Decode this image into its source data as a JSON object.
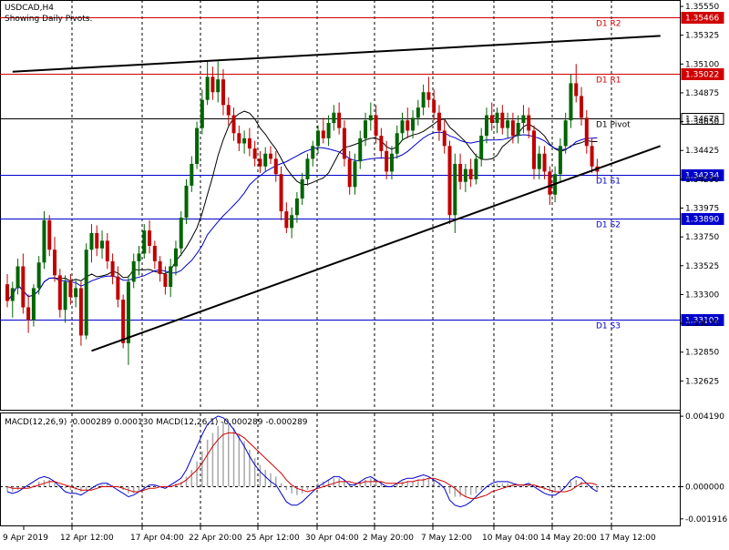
{
  "header": {
    "symbol": "USDCAD,H4",
    "subtitle": "Showing Daily Pivots.",
    "macd_label": "MACD(12,26,9) -0.000289 0.000130 MACD(12,26,1) -0.000289 -0.000289"
  },
  "colors": {
    "candle_up": "#006400",
    "candle_down": "#c00000",
    "pivot_red": "#d00000",
    "pivot_blue": "#0000cc",
    "pivot_black": "#000000",
    "ma_black": "#000000",
    "ma_blue": "#0000cc",
    "macd_hist": "#a8a8a8",
    "macd_main": "#0000cc",
    "macd_signal": "#d00000"
  },
  "chart_data": [
    {
      "type": "candlestick",
      "symbol": "USDCAD",
      "timeframe": "H4",
      "x_ticks": [
        "9 Apr 2019",
        "12 Apr 12:00",
        "17 Apr 04:00",
        "22 Apr 20:00",
        "25 Apr 12:00",
        "30 Apr 04:00",
        "2 May 20:00",
        "7 May 12:00",
        "10 May 04:00",
        "14 May 20:00",
        "17 May 12:00"
      ],
      "y_ticks": [
        "1.35550",
        "1.35325",
        "1.35100",
        "1.34875",
        "1.34650",
        "1.34425",
        "1.34200",
        "1.33975",
        "1.33750",
        "1.33525",
        "1.33300",
        "1.33075",
        "1.32850",
        "1.32625"
      ],
      "ylim": [
        1.324,
        1.356
      ],
      "pivots": [
        {
          "name": "D1 R2",
          "value": 1.35466,
          "label": "1.35466",
          "color": "red"
        },
        {
          "name": "D1 R1",
          "value": 1.35022,
          "label": "1.35022",
          "color": "red"
        },
        {
          "name": "D1 Pivot",
          "value": 1.34678,
          "label": "1.34678",
          "color": "black"
        },
        {
          "name": "D1 S1",
          "value": 1.34234,
          "label": "1.34234",
          "color": "blue"
        },
        {
          "name": "D1 S2",
          "value": 1.3389,
          "label": "1.33890",
          "color": "blue"
        },
        {
          "name": "D1 S3",
          "value": 1.33102,
          "label": "1.33102",
          "color": "blue"
        }
      ],
      "current_price": 1.34234,
      "trendlines": [
        {
          "from": {
            "bar": 1,
            "price": 1.3504
          },
          "to": {
            "bar": 124,
            "price": 1.3532
          }
        },
        {
          "from": {
            "bar": 16,
            "price": 1.3286
          },
          "to": {
            "bar": 124,
            "price": 1.3446
          }
        }
      ],
      "ohlc": [
        [
          1.3338,
          1.3346,
          1.332,
          1.3325
        ],
        [
          1.3325,
          1.334,
          1.3312,
          1.3335
        ],
        [
          1.3335,
          1.3358,
          1.333,
          1.3352
        ],
        [
          1.3352,
          1.3362,
          1.3315,
          1.332
        ],
        [
          1.332,
          1.333,
          1.33,
          1.331
        ],
        [
          1.331,
          1.3338,
          1.3305,
          1.3335
        ],
        [
          1.3335,
          1.336,
          1.333,
          1.3355
        ],
        [
          1.3355,
          1.3395,
          1.335,
          1.3388
        ],
        [
          1.3388,
          1.3392,
          1.336,
          1.3365
        ],
        [
          1.3365,
          1.3375,
          1.334,
          1.3345
        ],
        [
          1.3345,
          1.335,
          1.3312,
          1.3318
        ],
        [
          1.3318,
          1.3345,
          1.3308,
          1.334
        ],
        [
          1.334,
          1.3346,
          1.3322,
          1.3328
        ],
        [
          1.3328,
          1.3342,
          1.332,
          1.3335
        ],
        [
          1.3335,
          1.334,
          1.329,
          1.3298
        ],
        [
          1.3298,
          1.337,
          1.3295,
          1.3365
        ],
        [
          1.3365,
          1.3385,
          1.3355,
          1.3378
        ],
        [
          1.3378,
          1.3384,
          1.336,
          1.3366
        ],
        [
          1.3366,
          1.338,
          1.3358,
          1.3372
        ],
        [
          1.3372,
          1.3378,
          1.335,
          1.3356
        ],
        [
          1.3356,
          1.3362,
          1.3338,
          1.3344
        ],
        [
          1.3344,
          1.3352,
          1.332,
          1.3326
        ],
        [
          1.3326,
          1.333,
          1.3288,
          1.3292
        ],
        [
          1.3292,
          1.3345,
          1.3275,
          1.334
        ],
        [
          1.334,
          1.3362,
          1.3335,
          1.3356
        ],
        [
          1.3356,
          1.3368,
          1.3345,
          1.3362
        ],
        [
          1.3362,
          1.3385,
          1.3358,
          1.338
        ],
        [
          1.338,
          1.3388,
          1.3362,
          1.3368
        ],
        [
          1.3368,
          1.3372,
          1.335,
          1.3356
        ],
        [
          1.3356,
          1.336,
          1.334,
          1.3346
        ],
        [
          1.3346,
          1.3352,
          1.333,
          1.3336
        ],
        [
          1.3336,
          1.3358,
          1.3328,
          1.3352
        ],
        [
          1.3352,
          1.3372,
          1.3345,
          1.3366
        ],
        [
          1.3366,
          1.3395,
          1.336,
          1.339
        ],
        [
          1.339,
          1.342,
          1.3385,
          1.3415
        ],
        [
          1.3415,
          1.3438,
          1.341,
          1.3432
        ],
        [
          1.3432,
          1.3465,
          1.3428,
          1.346
        ],
        [
          1.346,
          1.349,
          1.3455,
          1.3482
        ],
        [
          1.3482,
          1.3512,
          1.3478,
          1.35
        ],
        [
          1.35,
          1.3508,
          1.3482,
          1.3488
        ],
        [
          1.3488,
          1.3512,
          1.348,
          1.3498
        ],
        [
          1.3498,
          1.3506,
          1.347,
          1.3478
        ],
        [
          1.3478,
          1.3484,
          1.3462,
          1.347
        ],
        [
          1.347,
          1.3476,
          1.345,
          1.3456
        ],
        [
          1.3456,
          1.3462,
          1.3442,
          1.3448
        ],
        [
          1.3448,
          1.3458,
          1.344,
          1.3452
        ],
        [
          1.3452,
          1.346,
          1.3438,
          1.3444
        ],
        [
          1.3444,
          1.345,
          1.343,
          1.3436
        ],
        [
          1.3436,
          1.3442,
          1.3425,
          1.343
        ],
        [
          1.343,
          1.3445,
          1.3426,
          1.344
        ],
        [
          1.344,
          1.3446,
          1.3432,
          1.3436
        ],
        [
          1.3436,
          1.3442,
          1.3418,
          1.3424
        ],
        [
          1.3424,
          1.343,
          1.3388,
          1.3395
        ],
        [
          1.3395,
          1.3402,
          1.3378,
          1.3382
        ],
        [
          1.3382,
          1.3398,
          1.3374,
          1.3392
        ],
        [
          1.3392,
          1.341,
          1.3386,
          1.3405
        ],
        [
          1.3405,
          1.3425,
          1.34,
          1.342
        ],
        [
          1.342,
          1.344,
          1.3415,
          1.3436
        ],
        [
          1.3436,
          1.345,
          1.343,
          1.3446
        ],
        [
          1.3446,
          1.3462,
          1.344,
          1.3458
        ],
        [
          1.3458,
          1.3468,
          1.3448,
          1.3452
        ],
        [
          1.3452,
          1.347,
          1.3446,
          1.3464
        ],
        [
          1.3464,
          1.3478,
          1.3458,
          1.3472
        ],
        [
          1.3472,
          1.348,
          1.3455,
          1.346
        ],
        [
          1.346,
          1.3466,
          1.343,
          1.3436
        ],
        [
          1.3436,
          1.3442,
          1.3408,
          1.3414
        ],
        [
          1.3414,
          1.344,
          1.3408,
          1.3434
        ],
        [
          1.3434,
          1.3458,
          1.3428,
          1.3452
        ],
        [
          1.3452,
          1.3472,
          1.3446,
          1.3466
        ],
        [
          1.3466,
          1.348,
          1.3458,
          1.347
        ],
        [
          1.347,
          1.3478,
          1.3448,
          1.3454
        ],
        [
          1.3454,
          1.346,
          1.3436,
          1.3442
        ],
        [
          1.3442,
          1.345,
          1.342,
          1.3426
        ],
        [
          1.3426,
          1.3446,
          1.342,
          1.344
        ],
        [
          1.344,
          1.3462,
          1.3436,
          1.3456
        ],
        [
          1.3456,
          1.3472,
          1.345,
          1.3466
        ],
        [
          1.3466,
          1.3476,
          1.3452,
          1.3458
        ],
        [
          1.3458,
          1.3474,
          1.3452,
          1.3468
        ],
        [
          1.3468,
          1.3482,
          1.3462,
          1.3476
        ],
        [
          1.3476,
          1.3494,
          1.347,
          1.3488
        ],
        [
          1.3488,
          1.35,
          1.3476,
          1.3482
        ],
        [
          1.3482,
          1.349,
          1.3466,
          1.3472
        ],
        [
          1.3472,
          1.3478,
          1.345,
          1.3458
        ],
        [
          1.3458,
          1.3466,
          1.344,
          1.3446
        ],
        [
          1.3446,
          1.345,
          1.3385,
          1.3392
        ],
        [
          1.3392,
          1.344,
          1.3378,
          1.3432
        ],
        [
          1.3432,
          1.344,
          1.3412,
          1.3418
        ],
        [
          1.3418,
          1.3432,
          1.341,
          1.3428
        ],
        [
          1.3428,
          1.3436,
          1.3414,
          1.342
        ],
        [
          1.342,
          1.344,
          1.3416,
          1.3436
        ],
        [
          1.3436,
          1.346,
          1.343,
          1.3454
        ],
        [
          1.3454,
          1.3476,
          1.3448,
          1.347
        ],
        [
          1.347,
          1.348,
          1.3458,
          1.3464
        ],
        [
          1.3464,
          1.3476,
          1.3456,
          1.3472
        ],
        [
          1.3472,
          1.3478,
          1.3455,
          1.346
        ],
        [
          1.346,
          1.3472,
          1.3452,
          1.3466
        ],
        [
          1.3466,
          1.3472,
          1.3448,
          1.3454
        ],
        [
          1.3454,
          1.347,
          1.3448,
          1.3464
        ],
        [
          1.3464,
          1.3478,
          1.3456,
          1.347
        ],
        [
          1.347,
          1.3476,
          1.3452,
          1.3458
        ],
        [
          1.3458,
          1.3462,
          1.342,
          1.3428
        ],
        [
          1.3428,
          1.3446,
          1.342,
          1.344
        ],
        [
          1.344,
          1.3446,
          1.342,
          1.3426
        ],
        [
          1.3426,
          1.343,
          1.34,
          1.3408
        ],
        [
          1.3408,
          1.343,
          1.3402,
          1.3424
        ],
        [
          1.3424,
          1.3452,
          1.3418,
          1.3446
        ],
        [
          1.3446,
          1.3472,
          1.344,
          1.3466
        ],
        [
          1.3466,
          1.3502,
          1.346,
          1.3495
        ],
        [
          1.3495,
          1.351,
          1.348,
          1.3485
        ],
        [
          1.3485,
          1.3492,
          1.3462,
          1.3468
        ],
        [
          1.3468,
          1.3474,
          1.344,
          1.3446
        ],
        [
          1.3446,
          1.3452,
          1.3425,
          1.343
        ],
        [
          1.343,
          1.3436,
          1.342,
          1.3426
        ]
      ],
      "ma_black_note": "smoothed average line",
      "ma_blue_note": "smoothed average line"
    },
    {
      "type": "macd",
      "title": "MACD(12,26,9) -0.000289 0.000130 MACD(12,26,1) -0.000289 -0.000289",
      "y_ticks": [
        "0.004190",
        "0.000000",
        "-0.001916"
      ],
      "ylim": [
        -0.00225,
        0.00425
      ],
      "histogram": [
        -0.0003,
        -0.0003,
        -0.0002,
        -0.0001,
        0.0,
        0.0001,
        0.0003,
        0.0004,
        0.0004,
        0.0003,
        0.0001,
        -0.0001,
        -0.0002,
        -0.0002,
        -0.0003,
        -0.0002,
        -0.0001,
        0.0,
        0.0001,
        0.0002,
        0.0001,
        0.0,
        -0.0002,
        -0.0004,
        -0.0004,
        -0.0003,
        -0.0002,
        0.0,
        0.0001,
        0.0,
        0.0,
        0.0001,
        0.0002,
        0.0003,
        0.0006,
        0.001,
        0.0015,
        0.0021,
        0.0028,
        0.0032,
        0.0036,
        0.0038,
        0.0037,
        0.0035,
        0.0031,
        0.0027,
        0.0022,
        0.0017,
        0.0013,
        0.001,
        0.0008,
        0.0006,
        0.0002,
        -0.0002,
        -0.0004,
        -0.0005,
        -0.0004,
        -0.0002,
        0.0,
        0.0002,
        0.0003,
        0.0004,
        0.0005,
        0.0005,
        0.0004,
        0.0002,
        0.0002,
        0.0003,
        0.0004,
        0.0005,
        0.0004,
        0.0003,
        0.0001,
        0.0001,
        0.0002,
        0.0003,
        0.0003,
        0.0003,
        0.0004,
        0.0005,
        0.0005,
        0.0004,
        0.0002,
        0.0,
        -0.0004,
        -0.0006,
        -0.0006,
        -0.0006,
        -0.0005,
        -0.0004,
        -0.0002,
        0.0,
        0.0001,
        0.0002,
        0.0002,
        0.0002,
        0.0001,
        0.0001,
        0.0001,
        0.0001,
        0.0,
        -0.0001,
        -0.0002,
        -0.0003,
        -0.0003,
        -0.0002,
        0.0,
        0.0003,
        0.0004,
        0.0003,
        0.0001,
        -0.0001,
        -0.0003
      ],
      "main": [
        -0.0003,
        -0.0004,
        -0.0003,
        -0.0001,
        0.0001,
        0.0003,
        0.0005,
        0.0006,
        0.0005,
        0.0003,
        0.0,
        -0.0003,
        -0.0004,
        -0.0004,
        -0.0005,
        -0.0003,
        -0.0001,
        0.0001,
        0.0002,
        0.0002,
        0.0,
        -0.0002,
        -0.0004,
        -0.0006,
        -0.0005,
        -0.0003,
        -0.0001,
        0.0001,
        0.0001,
        0.0,
        -0.0001,
        0.0001,
        0.0003,
        0.0005,
        0.001,
        0.0017,
        0.0024,
        0.0031,
        0.0037,
        0.004,
        0.0042,
        0.0041,
        0.0038,
        0.0034,
        0.0029,
        0.0024,
        0.0018,
        0.0013,
        0.0009,
        0.0006,
        0.0003,
        0.0001,
        -0.0004,
        -0.0009,
        -0.0011,
        -0.0011,
        -0.0009,
        -0.0006,
        -0.0003,
        0.0,
        0.0002,
        0.0004,
        0.0006,
        0.0006,
        0.0004,
        0.0001,
        0.0001,
        0.0003,
        0.0005,
        0.0006,
        0.0004,
        0.0002,
        0.0,
        0.0,
        0.0002,
        0.0004,
        0.0005,
        0.0005,
        0.0006,
        0.0007,
        0.0006,
        0.0004,
        0.0002,
        -0.0001,
        -0.0008,
        -0.0011,
        -0.0012,
        -0.0011,
        -0.0009,
        -0.0006,
        -0.0003,
        0.0,
        0.0002,
        0.0003,
        0.0003,
        0.0003,
        0.0002,
        0.0001,
        0.0001,
        0.0002,
        0.0,
        -0.0002,
        -0.0004,
        -0.0005,
        -0.0005,
        -0.0003,
        0.0,
        0.0004,
        0.0006,
        0.0005,
        0.0002,
        -0.0001,
        -0.0003
      ],
      "signal": [
        0.0,
        -0.0001,
        -0.0001,
        -0.0001,
        -0.0001,
        0.0,
        0.0001,
        0.0002,
        0.0003,
        0.0003,
        0.0002,
        0.0001,
        0.0,
        -0.0001,
        -0.0002,
        -0.0002,
        -0.0002,
        -0.0001,
        0.0,
        0.0,
        0.0,
        0.0,
        -0.0001,
        -0.0002,
        -0.0003,
        -0.0003,
        -0.0002,
        -0.0001,
        -0.0001,
        0.0,
        0.0,
        0.0,
        0.0001,
        0.0002,
        0.0004,
        0.0007,
        0.001,
        0.0014,
        0.0019,
        0.0024,
        0.0028,
        0.0031,
        0.0032,
        0.0032,
        0.0031,
        0.0029,
        0.0026,
        0.0023,
        0.002,
        0.0017,
        0.0014,
        0.0011,
        0.0008,
        0.0004,
        0.0001,
        -0.0001,
        -0.0002,
        -0.0003,
        -0.0002,
        -0.0001,
        0.0,
        0.0001,
        0.0002,
        0.0003,
        0.0003,
        0.0003,
        0.0002,
        0.0002,
        0.0003,
        0.0003,
        0.0003,
        0.0003,
        0.0002,
        0.0002,
        0.0002,
        0.0002,
        0.0003,
        0.0003,
        0.0004,
        0.0004,
        0.0005,
        0.0005,
        0.0004,
        0.0003,
        0.0001,
        -0.0001,
        -0.0004,
        -0.0006,
        -0.0007,
        -0.0007,
        -0.0006,
        -0.0005,
        -0.0003,
        -0.0002,
        -0.0001,
        0.0,
        0.0001,
        0.0001,
        0.0001,
        0.0001,
        0.0001,
        0.0,
        -0.0001,
        -0.0002,
        -0.0003,
        -0.0003,
        -0.0003,
        -0.0002,
        0.0,
        0.0002,
        0.0002,
        0.0002,
        0.0001
      ]
    }
  ]
}
